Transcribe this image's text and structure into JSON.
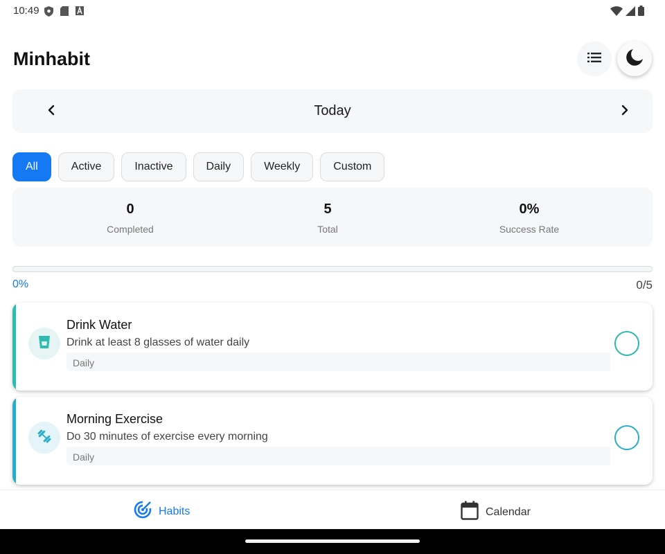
{
  "status_bar": {
    "time": "10:49",
    "left_icons": [
      "shield-icon",
      "sd-card-icon",
      "font-icon"
    ],
    "right_icons": [
      "wifi-icon",
      "signal-icon",
      "battery-icon"
    ]
  },
  "header": {
    "title": "Minhabit",
    "list_icon": "list-icon",
    "theme_icon": "moon-icon"
  },
  "date_nav": {
    "label": "Today",
    "prev_icon": "chevron-left-icon",
    "next_icon": "chevron-right-icon"
  },
  "filters": [
    {
      "label": "All",
      "active": true
    },
    {
      "label": "Active",
      "active": false
    },
    {
      "label": "Inactive",
      "active": false
    },
    {
      "label": "Daily",
      "active": false
    },
    {
      "label": "Weekly",
      "active": false
    },
    {
      "label": "Custom",
      "active": false
    }
  ],
  "stats": {
    "completed": {
      "value": "0",
      "label": "Completed"
    },
    "total": {
      "value": "5",
      "label": "Total"
    },
    "success_rate": {
      "value": "0%",
      "label": "Success Rate"
    }
  },
  "progress": {
    "percent_text": "0%",
    "count_text": "0/5",
    "fraction": 0
  },
  "habits": [
    {
      "title": "Drink Water",
      "description": "Drink at least 8 glasses of water daily",
      "frequency": "Daily",
      "icon": "water-glass-icon",
      "accent": "#2bbdb0",
      "completed": false
    },
    {
      "title": "Morning Exercise",
      "description": "Do 30 minutes of exercise every morning",
      "frequency": "Daily",
      "icon": "dumbbell-icon",
      "accent": "#26aec7",
      "completed": false
    }
  ],
  "bottom_nav": {
    "habits": {
      "label": "Habits",
      "icon": "target-icon",
      "active": true
    },
    "calendar": {
      "label": "Calendar",
      "icon": "calendar-icon",
      "active": false
    }
  },
  "colors": {
    "primary": "#1479f2",
    "teal": "#2bb8ad",
    "surface": "#f6f7f9"
  }
}
